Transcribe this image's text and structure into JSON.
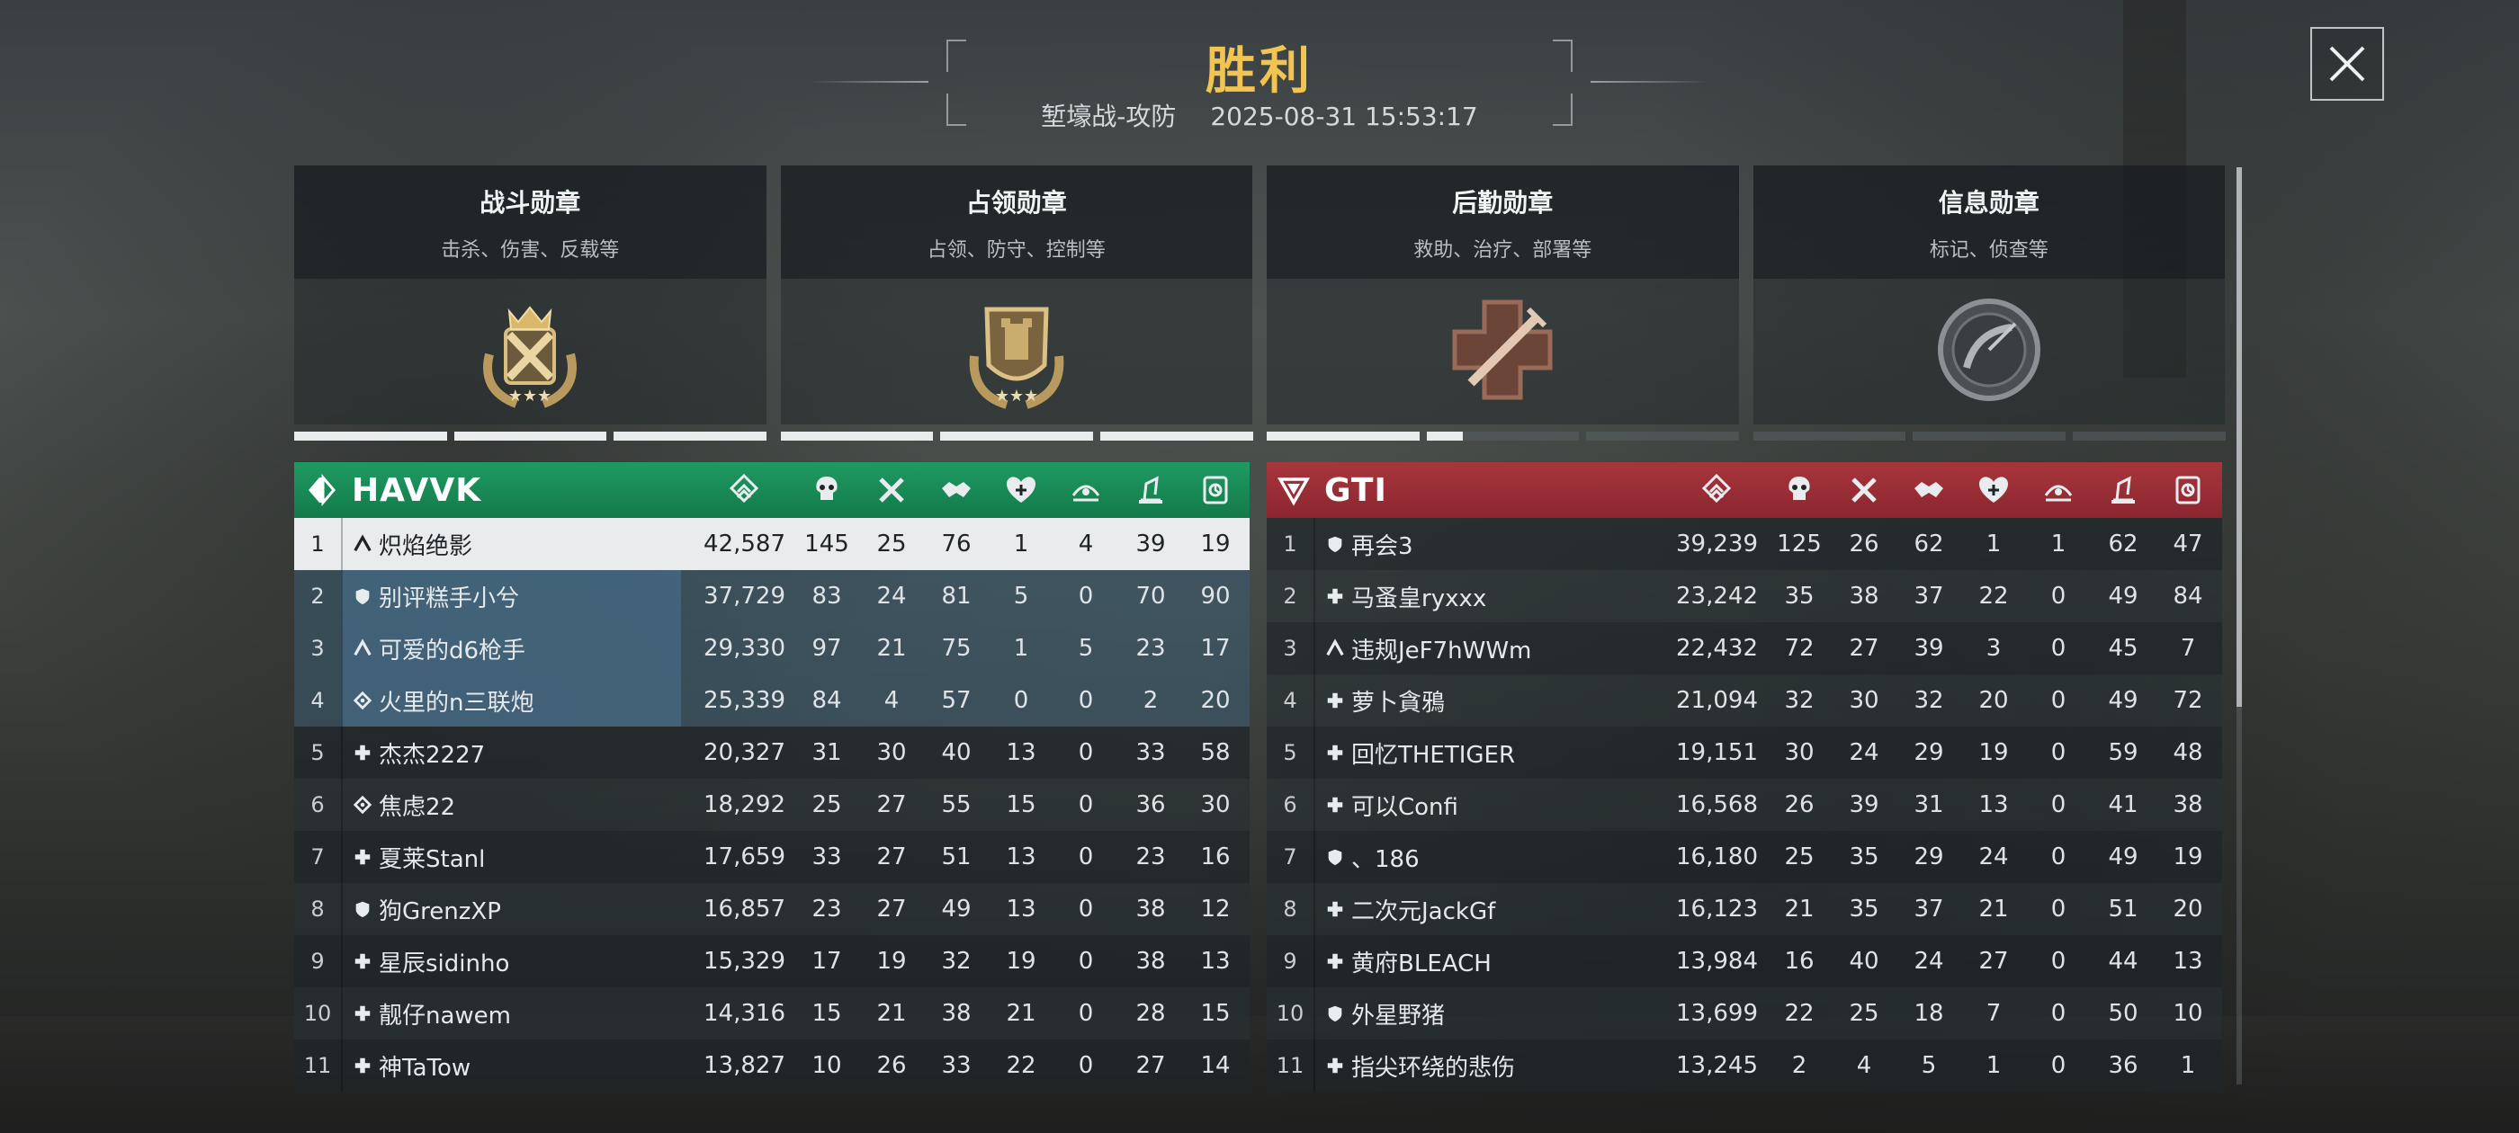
{
  "header": {
    "title": "胜利",
    "mode": "堑壕战-攻防",
    "datetime": "2025-08-31 15:53:17"
  },
  "medals": [
    {
      "name": "战斗勋章",
      "desc": "击杀、伤害、反载等",
      "icon": "combat-medal-icon",
      "progress": [
        1,
        1,
        1
      ]
    },
    {
      "name": "占领勋章",
      "desc": "占领、防守、控制等",
      "icon": "capture-medal-icon",
      "progress": [
        1,
        1,
        1
      ]
    },
    {
      "name": "后勤勋章",
      "desc": "救助、治疗、部署等",
      "icon": "logistics-medal-icon",
      "progress": [
        1,
        0.24,
        0
      ]
    },
    {
      "name": "信息勋章",
      "desc": "标记、侦查等",
      "icon": "intel-medal-icon",
      "progress": [
        0,
        0,
        0
      ]
    }
  ],
  "stat_icons": [
    "score-icon",
    "kills-icon",
    "deaths-icon",
    "assists-icon",
    "revive-icon",
    "capture-icon",
    "build-icon",
    "intel-icon"
  ],
  "teams": [
    {
      "name": "HAVVK",
      "color": "#1a8b57",
      "players": [
        {
          "rank": "1",
          "cls": "assault",
          "name": "炽焰绝影",
          "score": "42,587",
          "s1": "145",
          "s2": "25",
          "s3": "76",
          "s4": "1",
          "s5": "4",
          "s6": "39",
          "s7": "19"
        },
        {
          "rank": "2",
          "cls": "support",
          "name": "别评糕手小兮",
          "score": "37,729",
          "s1": "83",
          "s2": "24",
          "s3": "81",
          "s4": "5",
          "s5": "0",
          "s6": "70",
          "s7": "90"
        },
        {
          "rank": "3",
          "cls": "assault",
          "name": "可爱的d6枪手",
          "score": "29,330",
          "s1": "97",
          "s2": "21",
          "s3": "75",
          "s4": "1",
          "s5": "5",
          "s6": "23",
          "s7": "17"
        },
        {
          "rank": "4",
          "cls": "recon",
          "name": "火里的n三联炮",
          "score": "25,339",
          "s1": "84",
          "s2": "4",
          "s3": "57",
          "s4": "0",
          "s5": "0",
          "s6": "2",
          "s7": "20"
        },
        {
          "rank": "5",
          "cls": "medic",
          "name": "杰杰2227",
          "score": "20,327",
          "s1": "31",
          "s2": "30",
          "s3": "40",
          "s4": "13",
          "s5": "0",
          "s6": "33",
          "s7": "58"
        },
        {
          "rank": "6",
          "cls": "recon",
          "name": "焦虑22",
          "score": "18,292",
          "s1": "25",
          "s2": "27",
          "s3": "55",
          "s4": "15",
          "s5": "0",
          "s6": "36",
          "s7": "30"
        },
        {
          "rank": "7",
          "cls": "medic",
          "name": "夏莱Stanl",
          "score": "17,659",
          "s1": "33",
          "s2": "27",
          "s3": "51",
          "s4": "13",
          "s5": "0",
          "s6": "23",
          "s7": "16"
        },
        {
          "rank": "8",
          "cls": "support",
          "name": "狗GrenzXP",
          "score": "16,857",
          "s1": "23",
          "s2": "27",
          "s3": "49",
          "s4": "13",
          "s5": "0",
          "s6": "38",
          "s7": "12"
        },
        {
          "rank": "9",
          "cls": "medic",
          "name": "星辰sidinho",
          "score": "15,329",
          "s1": "17",
          "s2": "19",
          "s3": "32",
          "s4": "19",
          "s5": "0",
          "s6": "38",
          "s7": "13"
        },
        {
          "rank": "10",
          "cls": "medic",
          "name": "靓仔nawem",
          "score": "14,316",
          "s1": "15",
          "s2": "21",
          "s3": "38",
          "s4": "21",
          "s5": "0",
          "s6": "28",
          "s7": "15"
        },
        {
          "rank": "11",
          "cls": "medic",
          "name": "神TaTow",
          "score": "13,827",
          "s1": "10",
          "s2": "26",
          "s3": "33",
          "s4": "22",
          "s5": "0",
          "s6": "27",
          "s7": "14"
        }
      ]
    },
    {
      "name": "GTI",
      "color": "#9b2d35",
      "players": [
        {
          "rank": "1",
          "cls": "support",
          "name": "再会3",
          "score": "39,239",
          "s1": "125",
          "s2": "26",
          "s3": "62",
          "s4": "1",
          "s5": "1",
          "s6": "62",
          "s7": "47"
        },
        {
          "rank": "2",
          "cls": "medic",
          "name": "马蚤皇ryxxx",
          "score": "23,242",
          "s1": "35",
          "s2": "38",
          "s3": "37",
          "s4": "22",
          "s5": "0",
          "s6": "49",
          "s7": "84"
        },
        {
          "rank": "3",
          "cls": "assault",
          "name": "违规JeF7hWWm",
          "score": "22,432",
          "s1": "72",
          "s2": "27",
          "s3": "39",
          "s4": "3",
          "s5": "0",
          "s6": "45",
          "s7": "7"
        },
        {
          "rank": "4",
          "cls": "medic",
          "name": "萝卜貪鴉",
          "score": "21,094",
          "s1": "32",
          "s2": "30",
          "s3": "32",
          "s4": "20",
          "s5": "0",
          "s6": "49",
          "s7": "72"
        },
        {
          "rank": "5",
          "cls": "medic",
          "name": "回忆THETIGER",
          "score": "19,151",
          "s1": "30",
          "s2": "24",
          "s3": "29",
          "s4": "19",
          "s5": "0",
          "s6": "59",
          "s7": "48"
        },
        {
          "rank": "6",
          "cls": "medic",
          "name": "可以Confi",
          "score": "16,568",
          "s1": "26",
          "s2": "39",
          "s3": "31",
          "s4": "13",
          "s5": "0",
          "s6": "41",
          "s7": "38"
        },
        {
          "rank": "7",
          "cls": "support",
          "name": "、186",
          "score": "16,180",
          "s1": "25",
          "s2": "35",
          "s3": "29",
          "s4": "24",
          "s5": "0",
          "s6": "49",
          "s7": "19"
        },
        {
          "rank": "8",
          "cls": "medic",
          "name": "二次元JackGf",
          "score": "16,123",
          "s1": "21",
          "s2": "35",
          "s3": "37",
          "s4": "21",
          "s5": "0",
          "s6": "51",
          "s7": "20"
        },
        {
          "rank": "9",
          "cls": "medic",
          "name": "黄府BLEACH",
          "score": "13,984",
          "s1": "16",
          "s2": "40",
          "s3": "24",
          "s4": "27",
          "s5": "0",
          "s6": "44",
          "s7": "13"
        },
        {
          "rank": "10",
          "cls": "support",
          "name": "外星野猪",
          "score": "13,699",
          "s1": "22",
          "s2": "25",
          "s3": "18",
          "s4": "7",
          "s5": "0",
          "s6": "50",
          "s7": "10"
        },
        {
          "rank": "11",
          "cls": "medic",
          "name": "指尖环绕的悲伤",
          "score": "13,245",
          "s1": "2",
          "s2": "4",
          "s3": "5",
          "s4": "1",
          "s5": "0",
          "s6": "36",
          "s7": "1"
        }
      ]
    }
  ]
}
